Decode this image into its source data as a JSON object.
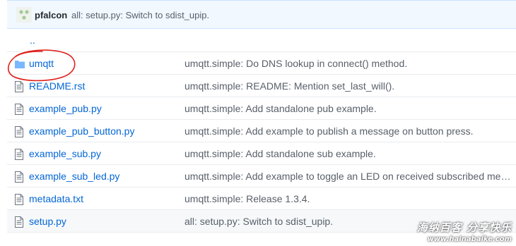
{
  "commit": {
    "author": "pfalcon",
    "message": "all: setup.py: Switch to sdist_upip."
  },
  "up_link": "..",
  "files": [
    {
      "type": "folder",
      "name": "umqtt",
      "message": "umqtt.simple: Do DNS lookup in connect() method."
    },
    {
      "type": "file",
      "name": "README.rst",
      "message": "umqtt.simple: README: Mention set_last_will()."
    },
    {
      "type": "file",
      "name": "example_pub.py",
      "message": "umqtt.simple: Add standalone pub example."
    },
    {
      "type": "file",
      "name": "example_pub_button.py",
      "message": "umqtt.simple: Add example to publish a message on button press."
    },
    {
      "type": "file",
      "name": "example_sub.py",
      "message": "umqtt.simple: Add standalone sub example."
    },
    {
      "type": "file",
      "name": "example_sub_led.py",
      "message": "umqtt.simple: Add example to toggle an LED on received subscribed mes..."
    },
    {
      "type": "file",
      "name": "metadata.txt",
      "message": "umqtt.simple: Release 1.3.4."
    },
    {
      "type": "file",
      "name": "setup.py",
      "message": "all: setup.py: Switch to sdist_upip."
    }
  ],
  "watermark": {
    "title": "海纳百客 分享快乐",
    "url": "www.hainabaike.com"
  },
  "colors": {
    "link": "#0366d6",
    "annotation": "#e0201b",
    "folder": "#79b8ff"
  }
}
